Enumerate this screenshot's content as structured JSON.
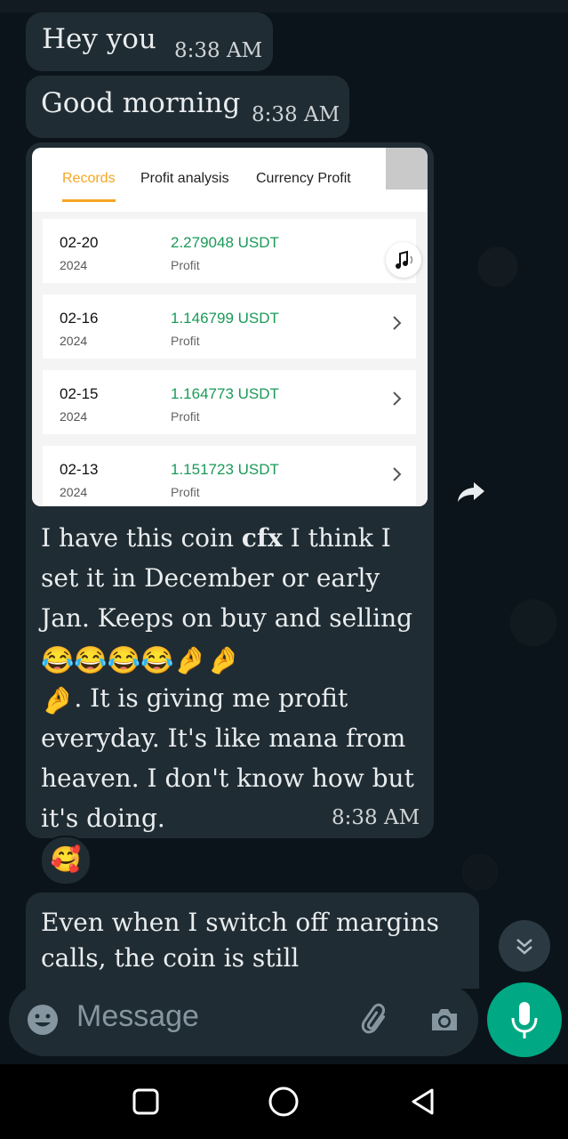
{
  "messages": [
    {
      "text": "Hey you",
      "time": "8:38 AM"
    },
    {
      "text": "Good morning",
      "time": "8:38 AM"
    }
  ],
  "image_message": {
    "screenshot": {
      "tabs": [
        "Records",
        "Profit analysis",
        "Currency Profit"
      ],
      "active_tab": "Records",
      "records": [
        {
          "date": "02-20",
          "year": "2024",
          "amount": "2.279048 USDT",
          "type": "Profit"
        },
        {
          "date": "02-16",
          "year": "2024",
          "amount": "1.146799 USDT",
          "type": "Profit"
        },
        {
          "date": "02-15",
          "year": "2024",
          "amount": "1.164773 USDT",
          "type": "Profit"
        },
        {
          "date": "02-13",
          "year": "2024",
          "amount": "1.151723 USDT",
          "type": "Profit"
        }
      ],
      "accent_color": "#f5a623",
      "profit_color": "#1a9a58"
    },
    "caption": {
      "part1": "I have this coin ",
      "bold": "cfx",
      "part2": " I think I set it in December or early Jan. Keeps on buy and selling",
      "emojis1": "😂😂😂😂🤌🤌",
      "emojis2": "🤌",
      "part3": ". It is giving me profit everyday. It's like mana from heaven. I don't know how but it's doing."
    },
    "time": "8:38 AM",
    "reaction": "🥰"
  },
  "partial_message": {
    "text": "Even when I switch off margins calls, the coin is still"
  },
  "composer": {
    "placeholder": "Message"
  },
  "icons": {
    "emoji": "smiley-icon",
    "attach": "paperclip-icon",
    "camera": "camera-icon",
    "mic": "microphone-icon",
    "forward": "forward-arrow-icon",
    "scroll": "double-chevron-down-icon",
    "nav": [
      "recents-square-icon",
      "home-circle-icon",
      "back-triangle-icon"
    ]
  },
  "colors": {
    "background": "#0b141a",
    "bubble": "#202c33",
    "mic_button": "#00a884",
    "text": "#e9edef",
    "muted": "#8696a0"
  }
}
